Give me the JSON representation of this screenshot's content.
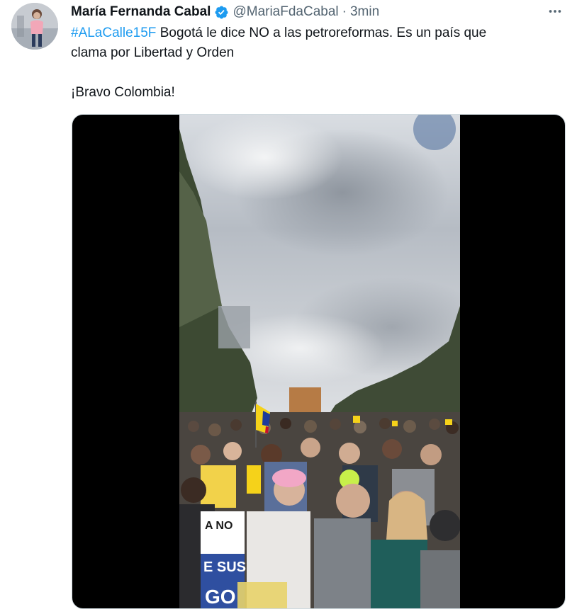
{
  "tweet": {
    "author": {
      "display_name": "María Fernanda Cabal",
      "handle": "@MariaFdaCabal",
      "verified_icon": "verified-badge-icon"
    },
    "separator": "·",
    "timestamp": "3min",
    "more_icon": "more-horizontal-icon",
    "text": {
      "hashtag": "#ALaCalle15F",
      "line1_rest": " Bogotá le dice NO a las petroreformas. Es un país que",
      "line2": "clama por Libertad y Orden",
      "line3": "¡Bravo Colombia!"
    },
    "media": {
      "type": "video",
      "banner_text_1": "A NO",
      "banner_text_2": "E SUS",
      "banner_text_3": "GO"
    }
  },
  "colors": {
    "accent": "#1d9bf0",
    "text_primary": "#0f1419",
    "text_secondary": "#536471",
    "flag_yellow": "#f5d21a",
    "flag_blue": "#1f3c9a",
    "flag_red": "#c8102e"
  }
}
